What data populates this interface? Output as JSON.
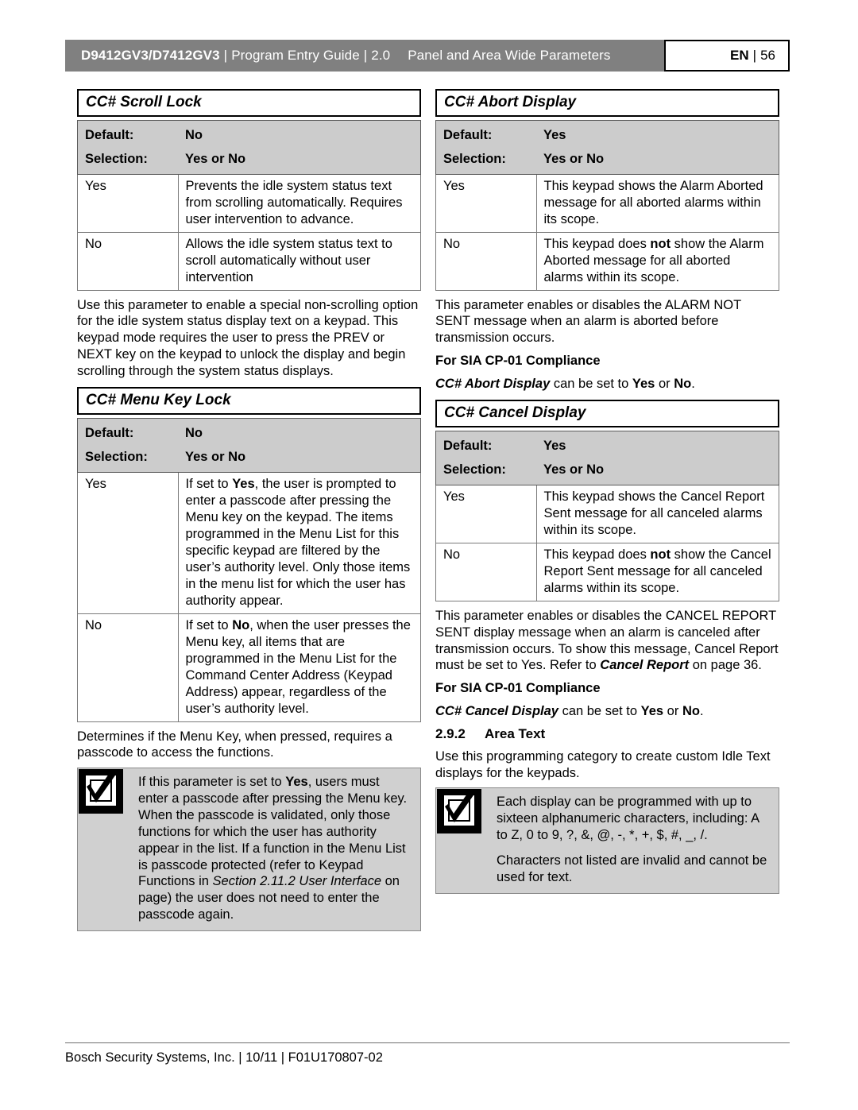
{
  "header": {
    "doc_model": "D9412GV3/D7412GV3",
    "sep": "|",
    "guide": "Program Entry Guide",
    "version": "2.0",
    "chapter_title": "Panel and Area Wide Parameters",
    "lang": "EN",
    "page_number": "56"
  },
  "left_column": {
    "scroll_lock": {
      "title": "CC# Scroll Lock",
      "default_label": "Default:",
      "default_value": "No",
      "selection_label": "Selection:",
      "selection_value": "Yes or No",
      "rows": [
        {
          "option": "Yes",
          "description": "Prevents the idle system status text from scrolling automatically. Requires user intervention to advance."
        },
        {
          "option": "No",
          "description": "Allows the idle system status text to scroll automatically without user intervention"
        }
      ],
      "body": "Use this parameter to enable a special non-scrolling option for the idle system status display text on a keypad. This keypad mode requires the user to press the PREV or NEXT key on the keypad to unlock the display and begin scrolling through the system status displays."
    },
    "menu_key_lock": {
      "title": "CC# Menu Key Lock",
      "default_label": "Default:",
      "default_value": "No",
      "selection_label": "Selection:",
      "selection_value": "Yes or No",
      "rows": [
        {
          "option": "Yes",
          "desc_pre": "If set to ",
          "desc_bold": "Yes",
          "desc_post": ", the user is prompted to enter a passcode after pressing the Menu key on the keypad. The items programmed in the Menu List for this specific keypad are filtered by the user’s authority level. Only those items in the menu list for which the user has authority appear."
        },
        {
          "option": "No",
          "desc_pre": "If set to ",
          "desc_bold": "No",
          "desc_post": ", when the user presses the Menu key, all items that are programmed in the Menu List for the Command Center Address (Keypad Address) appear, regardless of the user’s authority level."
        }
      ],
      "body": "Determines if the Menu Key, when pressed, requires a passcode to access the functions."
    },
    "notice": {
      "icon": "checkmark-box-icon",
      "text_pre": "If this parameter is set to ",
      "text_bold": "Yes",
      "text_mid": ", users must enter a passcode after pressing the Menu key. When the passcode is validated, only those functions for which the user has authority appear in the list. If a function in the Menu List is passcode protected (refer to Keypad Functions in ",
      "text_italic": "Section 2.11.2 User Interface",
      "text_post": " on page) the user does not need to enter the passcode again."
    }
  },
  "right_column": {
    "abort_display": {
      "title": "CC# Abort Display",
      "default_label": "Default:",
      "default_value": "Yes",
      "selection_label": "Selection:",
      "selection_value": "Yes or No",
      "rows": [
        {
          "option": "Yes",
          "description": "This keypad shows the Alarm Aborted message for all aborted alarms within its scope."
        },
        {
          "option": "No",
          "desc_pre": "This keypad does ",
          "desc_bold": "not",
          "desc_post": " show the Alarm Aborted message for all aborted alarms within its scope."
        }
      ],
      "body": "This parameter enables or disables the ALARM NOT SENT message when an alarm is aborted before transmission occurs.",
      "sia_heading": "For SIA CP-01 Compliance",
      "sia_name": "CC# Abort Display",
      "sia_mid": " can be set to ",
      "sia_yes": "Yes",
      "sia_or": " or ",
      "sia_no": "No",
      "sia_end": "."
    },
    "cancel_display": {
      "title": "CC# Cancel Display",
      "default_label": "Default:",
      "default_value": "Yes",
      "selection_label": "Selection:",
      "selection_value": "Yes or No",
      "rows": [
        {
          "option": "Yes",
          "description": "This keypad shows the Cancel Report Sent message for all canceled alarms within its scope."
        },
        {
          "option": "No",
          "desc_pre": "This keypad does ",
          "desc_bold": "not",
          "desc_post": " show the Cancel Report Sent message for all canceled alarms within its scope."
        }
      ],
      "body_pre": "This parameter enables or disables the CANCEL REPORT SENT display message when an alarm is canceled after transmission occurs. To show this message, Cancel Report must be set to Yes. Refer to ",
      "body_ref": "Cancel Report",
      "body_post": " on page 36.",
      "sia_heading": "For SIA CP-01 Compliance",
      "sia_name": "CC# Cancel Display",
      "sia_mid": " can be set to ",
      "sia_yes": "Yes",
      "sia_or": " or ",
      "sia_no": "No",
      "sia_end": "."
    },
    "area_text": {
      "number": "2.9.2",
      "title": "Area Text",
      "body": "Use this programming category to create custom Idle Text displays for the keypads."
    },
    "notice": {
      "icon": "checkmark-box-icon",
      "paragraph_1": "Each display can be programmed with up to sixteen alphanumeric characters, including: A to Z, 0 to 9,  ?,  &, @,  -,  *,  +,  $,  #,  _,  /.",
      "paragraph_2": "Characters not listed are invalid and cannot be used for text."
    }
  },
  "footer": {
    "text": "Bosch Security Systems, Inc. | 10/11 | F01U170807-02"
  }
}
